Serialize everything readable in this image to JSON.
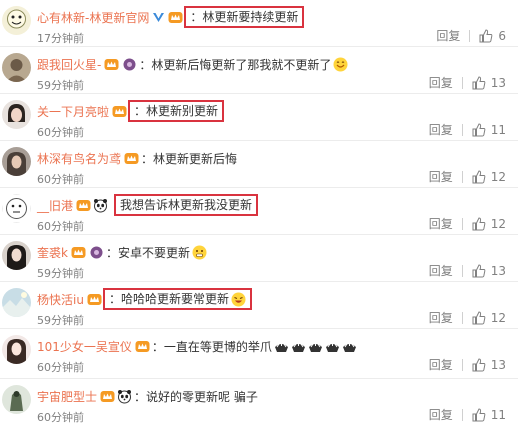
{
  "comments": [
    {
      "user": "心有林新-林更新官网",
      "text": "林更新要持续更新",
      "time": "17分钟前",
      "reply": "回复",
      "likes": "6",
      "highlight": true,
      "verified": true,
      "extra_badge": false
    },
    {
      "user": "跟我回火星-",
      "text": "林更新后悔更新了那我就不更新了",
      "time": "59分钟前",
      "reply": "回复",
      "likes": "13",
      "highlight": false,
      "extra_badge": true
    },
    {
      "user": "关一下月亮啦",
      "text": "林更新别更新",
      "time": "60分钟前",
      "reply": "回复",
      "likes": "11",
      "highlight": true
    },
    {
      "user": "林深有鸟名为鸢",
      "text": "林更新更新后悔",
      "time": "60分钟前",
      "reply": "回复",
      "likes": "12",
      "highlight": false
    },
    {
      "user": "__旧港",
      "text": "我想告诉林更新我没更新",
      "time": "60分钟前",
      "reply": "回复",
      "likes": "12",
      "highlight": true,
      "panda": true
    },
    {
      "user": "奎裘k",
      "text": "安卓不要更新",
      "time": "59分钟前",
      "reply": "回复",
      "likes": "13",
      "highlight": false,
      "extra_badge": true
    },
    {
      "user": "杨快活iu",
      "text": "哈哈哈更新要常更新",
      "time": "59分钟前",
      "reply": "回复",
      "likes": "12",
      "highlight": true
    },
    {
      "user": "101少女一吴宣仪",
      "text": "一直在等更博的举爪",
      "time": "60分钟前",
      "reply": "回复",
      "likes": "13",
      "highlight": false
    },
    {
      "user": "宇宙肥型士",
      "text": "说好的零更新呢 骗子",
      "time": "60分钟前",
      "reply": "回复",
      "likes": "11",
      "highlight": false,
      "panda": true
    }
  ],
  "colors": {
    "username": "#eb7350",
    "highlight_border": "#d9333f",
    "meta": "#808080"
  },
  "icons": {
    "like": "thumbs-up-icon",
    "member": "vip-crown-icon",
    "verified": "verified-v-icon",
    "panda": "panda-emoji-icon"
  }
}
